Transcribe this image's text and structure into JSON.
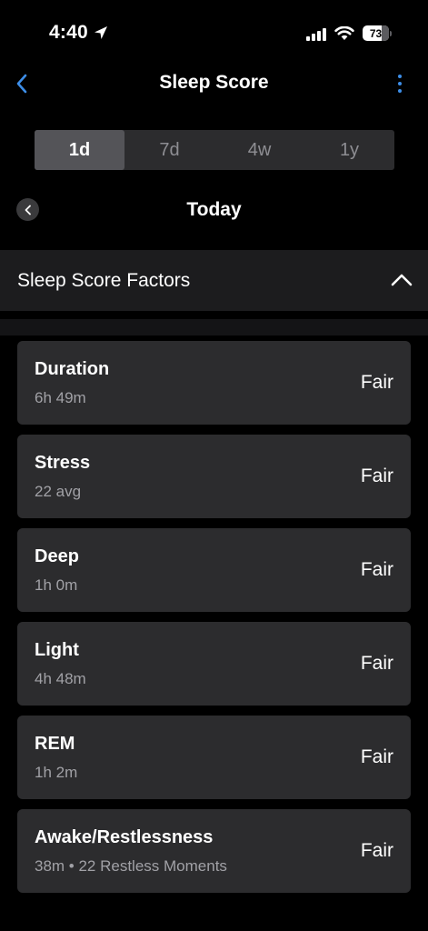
{
  "status_bar": {
    "time": "4:40",
    "battery": "73",
    "battery_level": 0.73
  },
  "nav": {
    "title": "Sleep Score"
  },
  "range_tabs": [
    {
      "label": "1d",
      "active": true
    },
    {
      "label": "7d",
      "active": false
    },
    {
      "label": "4w",
      "active": false
    },
    {
      "label": "1y",
      "active": false
    }
  ],
  "date": {
    "label": "Today"
  },
  "section": {
    "title": "Sleep Score Factors"
  },
  "factors": [
    {
      "name": "Duration",
      "value": "6h 49m",
      "rating": "Fair"
    },
    {
      "name": "Stress",
      "value": "22 avg",
      "rating": "Fair"
    },
    {
      "name": "Deep",
      "value": "1h 0m",
      "rating": "Fair"
    },
    {
      "name": "Light",
      "value": "4h 48m",
      "rating": "Fair"
    },
    {
      "name": "REM",
      "value": "1h 2m",
      "rating": "Fair"
    },
    {
      "name": "Awake/Restlessness",
      "value": "38m • 22 Restless Moments",
      "rating": "Fair"
    }
  ],
  "colors": {
    "accent": "#3d8ee8",
    "background": "#000000",
    "card": "#2c2c2e"
  },
  "icons": {
    "back": "chevron-left-icon",
    "more": "vertical-ellipsis-icon",
    "prev_day": "chevron-left-circle-icon",
    "collapse": "chevron-up-icon",
    "location": "location-arrow-icon"
  }
}
